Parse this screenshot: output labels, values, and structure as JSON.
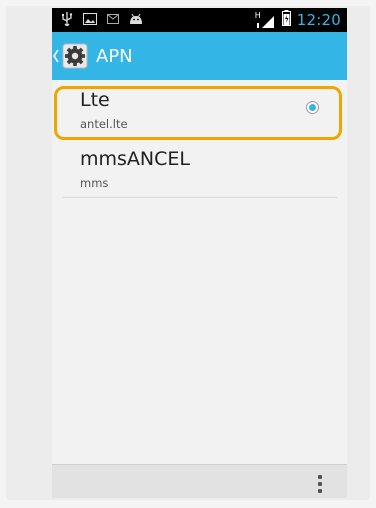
{
  "status_bar": {
    "time": "12:20",
    "network": "H",
    "icons": [
      "usb-icon",
      "image-icon",
      "mail-icon",
      "android-icon",
      "signal-icon",
      "battery-icon"
    ]
  },
  "action_bar": {
    "title": "APN",
    "icons": [
      "back-chevron-icon",
      "settings-gear-icon"
    ],
    "accent": "#33b5e5"
  },
  "apn_list": [
    {
      "name": "Lte",
      "apn": "antel.lte",
      "selected": true
    },
    {
      "name": "mmsANCEL",
      "apn": "mms",
      "selected": false
    }
  ],
  "highlight_color": "#f0a500",
  "bottom_bar": {
    "icon": "overflow-menu-icon"
  }
}
